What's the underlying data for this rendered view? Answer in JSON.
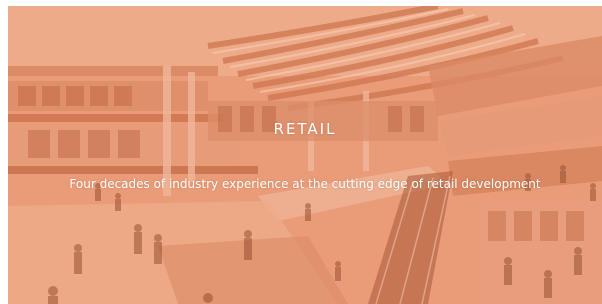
{
  "hero": {
    "title": "RETAIL",
    "tagline": "Four decades of industry experience at the cutting edge of retail development",
    "image_subject": "mall-atrium-illustration",
    "tint_color": "#e9a07f"
  }
}
